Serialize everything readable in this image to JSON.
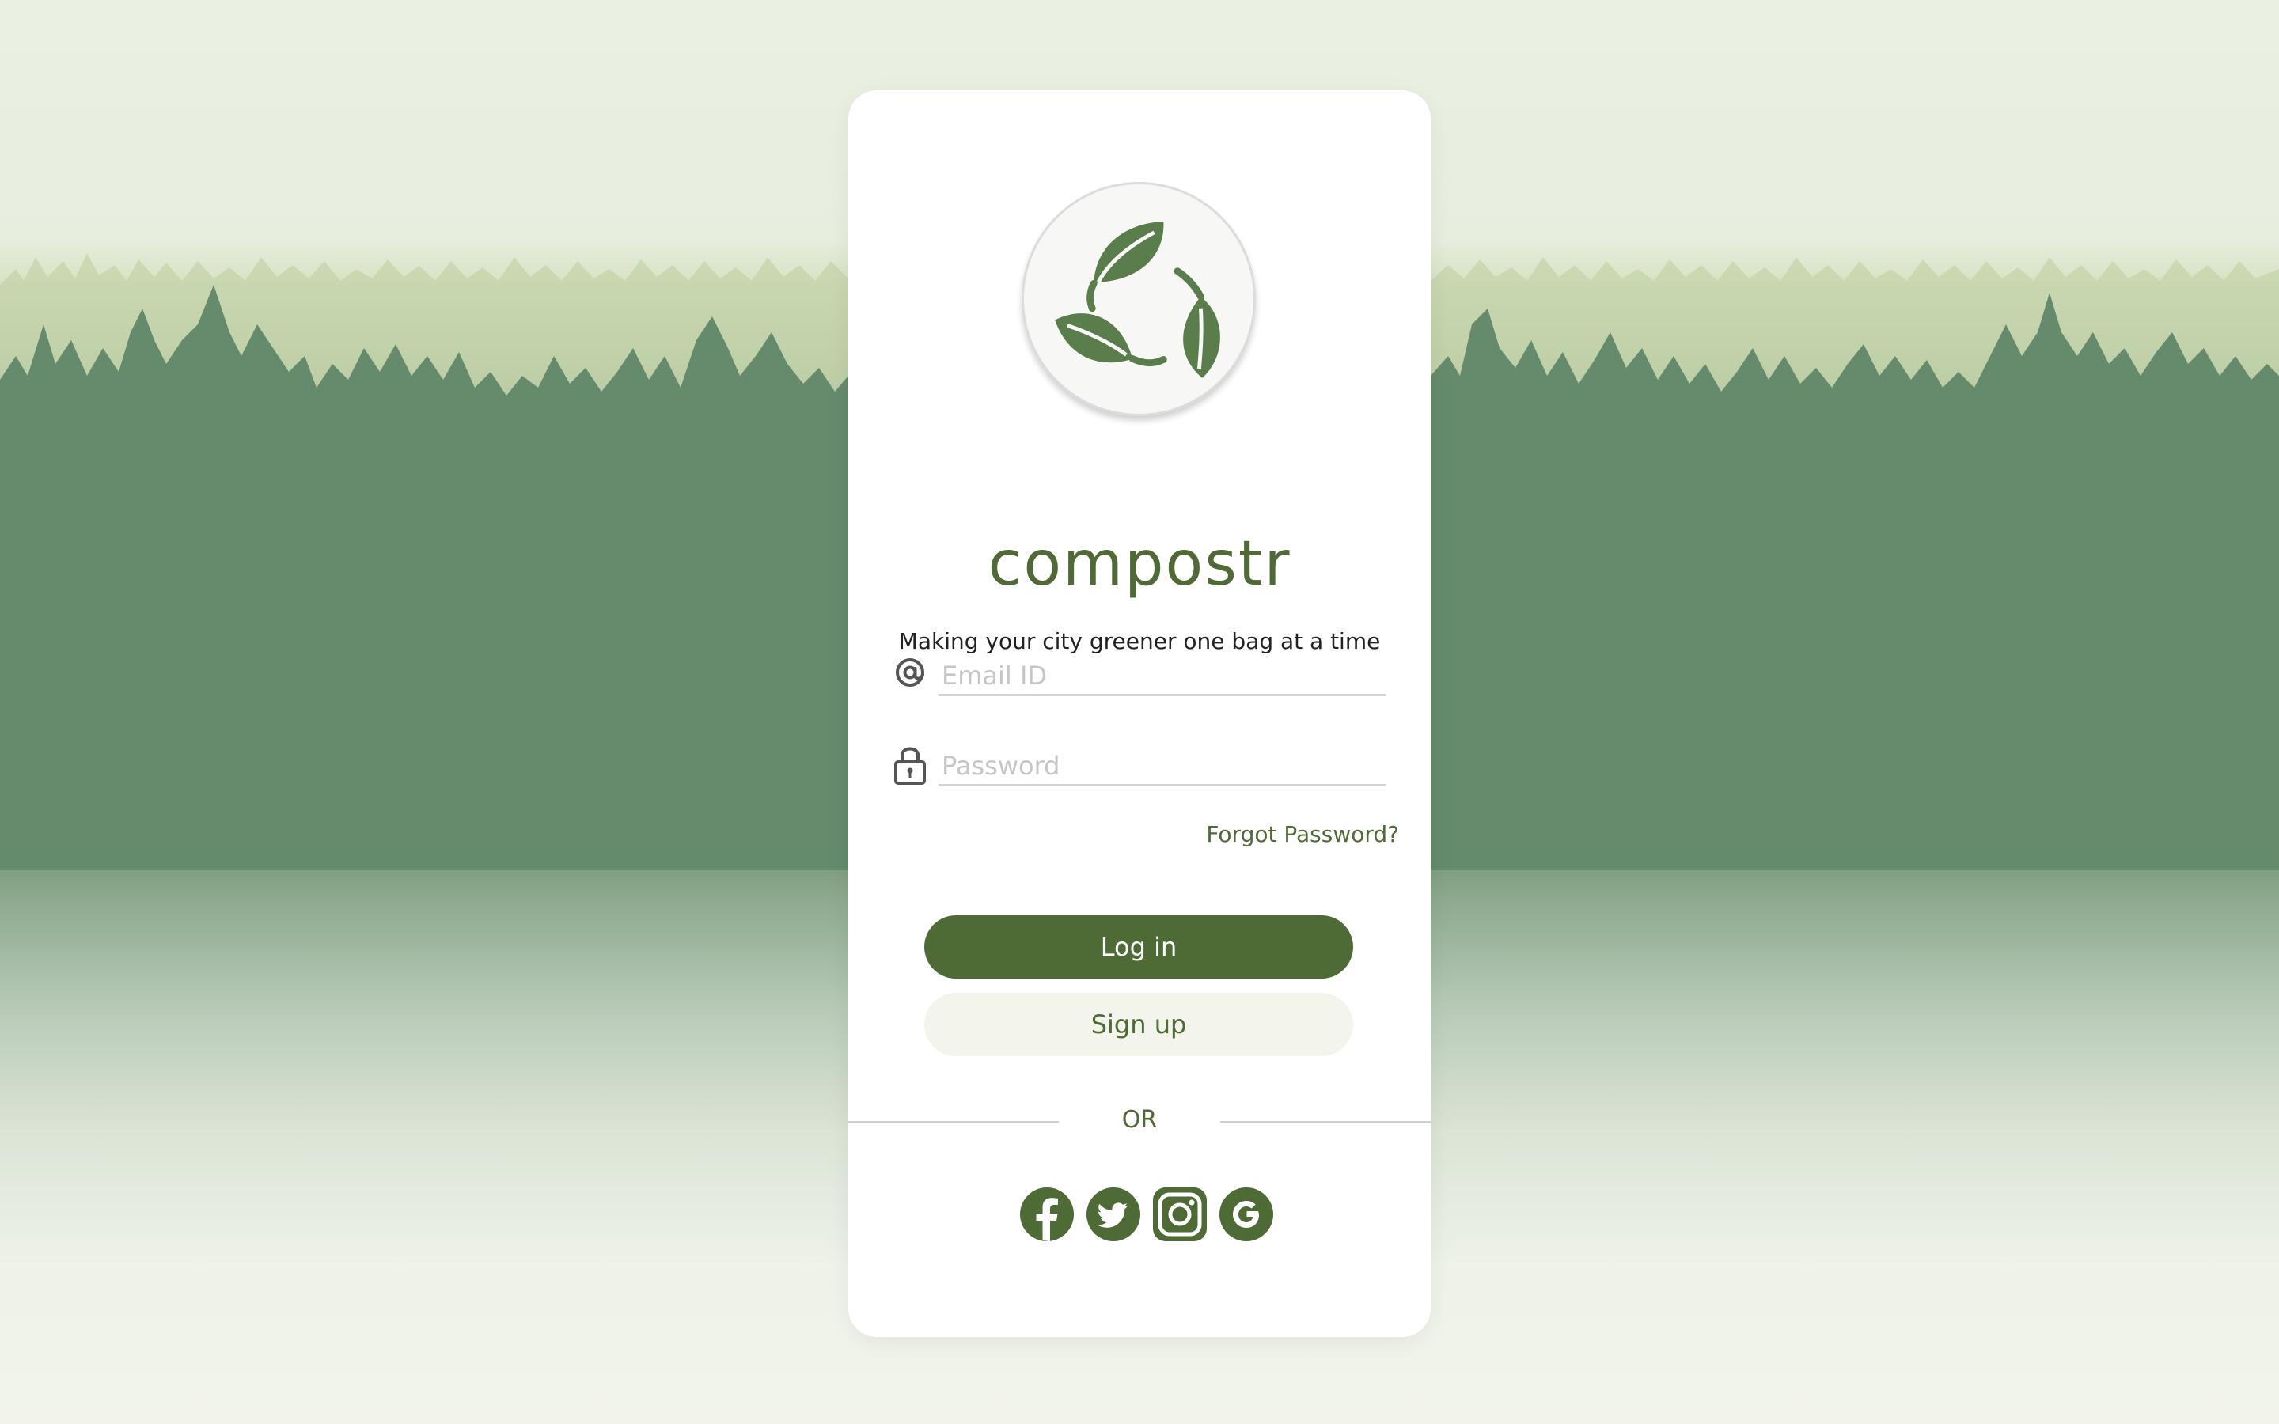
{
  "app": {
    "brand_name": "compostr",
    "tagline": "Making your city greener one bag at a time"
  },
  "form": {
    "email": {
      "placeholder": "Email ID",
      "value": "",
      "icon": "at-icon"
    },
    "password": {
      "placeholder": "Password",
      "value": "",
      "icon": "lock-icon"
    },
    "forgot_label": "Forgot Password?",
    "login_label": "Log in",
    "signup_label": "Sign up"
  },
  "divider": {
    "label": "OR"
  },
  "social": [
    {
      "name": "facebook-icon"
    },
    {
      "name": "twitter-icon"
    },
    {
      "name": "instagram-icon"
    },
    {
      "name": "google-icon"
    }
  ],
  "colors": {
    "brand_green": "#4e6a35",
    "signup_bg": "#f3f4eb",
    "forest_green": "#658a6c"
  }
}
